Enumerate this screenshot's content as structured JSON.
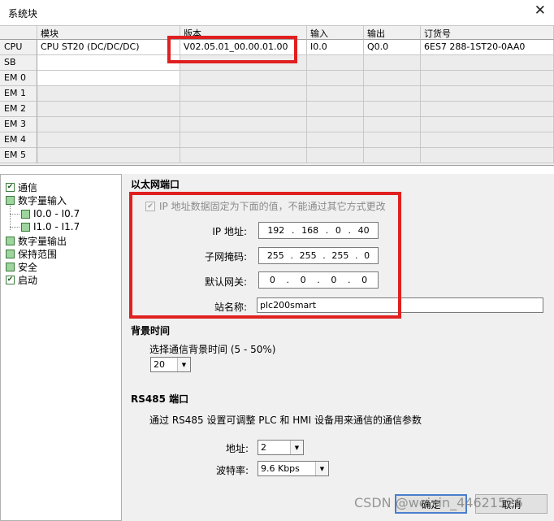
{
  "window": {
    "title": "系统块",
    "close_glyph": "✕"
  },
  "grid": {
    "headers": [
      "模块",
      "版本",
      "输入",
      "输出",
      "订货号"
    ],
    "rows": [
      {
        "head": "CPU",
        "module": "CPU ST20 (DC/DC/DC)",
        "version": "V02.05.01_00.00.01.00",
        "input": "I0.0",
        "output": "Q0.0",
        "order": "6ES7 288-1ST20-0AA0"
      },
      {
        "head": "SB",
        "module": "",
        "version": "",
        "input": "",
        "output": "",
        "order": ""
      },
      {
        "head": "EM 0",
        "module": "",
        "version": "",
        "input": "",
        "output": "",
        "order": ""
      },
      {
        "head": "EM 1",
        "module": "",
        "version": "",
        "input": "",
        "output": "",
        "order": ""
      },
      {
        "head": "EM 2",
        "module": "",
        "version": "",
        "input": "",
        "output": "",
        "order": ""
      },
      {
        "head": "EM 3",
        "module": "",
        "version": "",
        "input": "",
        "output": "",
        "order": ""
      },
      {
        "head": "EM 4",
        "module": "",
        "version": "",
        "input": "",
        "output": "",
        "order": ""
      },
      {
        "head": "EM 5",
        "module": "",
        "version": "",
        "input": "",
        "output": "",
        "order": ""
      }
    ]
  },
  "tree": {
    "items": [
      {
        "label": "通信",
        "state": "checked"
      },
      {
        "label": "数字量输入",
        "state": "green"
      },
      {
        "label": "I0.0 - I0.7",
        "state": "green"
      },
      {
        "label": "I1.0 - I1.7",
        "state": "green"
      },
      {
        "label": "数字量输出",
        "state": "green"
      },
      {
        "label": "保持范围",
        "state": "green"
      },
      {
        "label": "安全",
        "state": "green"
      },
      {
        "label": "启动",
        "state": "checked"
      }
    ],
    "check_glyph": "✔"
  },
  "ethernet": {
    "section_title": "以太网端口",
    "fixed_ip_label": "IP 地址数据固定为下面的值，不能通过其它方式更改",
    "fixed_ip_checked_glyph": "✔",
    "ip_label": "IP 地址:",
    "ip": [
      "192",
      "168",
      "0",
      "40"
    ],
    "subnet_label": "子网掩码:",
    "subnet": [
      "255",
      "255",
      "255",
      "0"
    ],
    "gateway_label": "默认网关:",
    "gateway": [
      "0",
      "0",
      "0",
      "0"
    ],
    "station_label": "站名称:",
    "station_name": "plc200smart"
  },
  "background": {
    "section_title": "背景时间",
    "select_label": "选择通信背景时间 (5 - 50%)",
    "value": "20"
  },
  "rs485": {
    "section_title": "RS485 端口",
    "description": "通过 RS485 设置可调整 PLC 和 HMI 设备用来通信的通信参数",
    "address_label": "地址:",
    "address_value": "2",
    "baud_label": "波特率:",
    "baud_value": "9.6 Kbps"
  },
  "buttons": {
    "ok": "确定",
    "cancel": "取消"
  },
  "watermark": "CSDN @weixin_44621526",
  "colors": {
    "highlight_box": "#e02020",
    "tree_green": "#9ed49e"
  },
  "icons": {
    "dropdown": "▼"
  }
}
